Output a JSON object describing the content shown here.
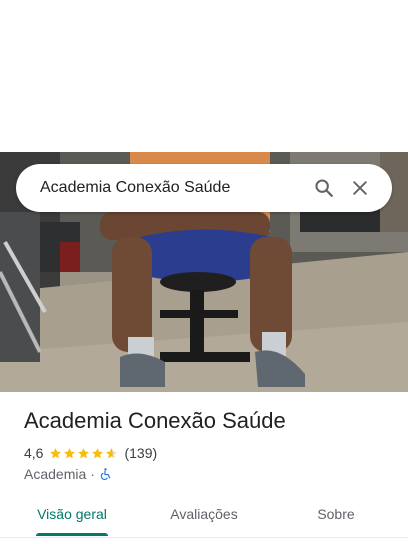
{
  "search": {
    "query": "Academia Conexão Saúde"
  },
  "place": {
    "name": "Academia Conexão Saúde",
    "rating": "4,6",
    "rating_value": 4.6,
    "review_count": "(139)",
    "category": "Academia",
    "separator": "·",
    "accessibility_icon": "wheelchair-icon"
  },
  "tabs": [
    {
      "label": "Visão geral",
      "active": true
    },
    {
      "label": "Avaliações",
      "active": false
    },
    {
      "label": "Sobre",
      "active": false
    }
  ],
  "colors": {
    "accent": "#00796b",
    "star": "#fbbc04",
    "accessibility": "#1a73e8"
  }
}
